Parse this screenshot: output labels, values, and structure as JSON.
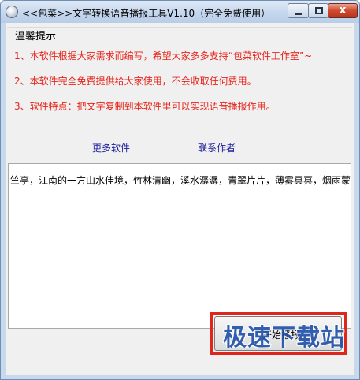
{
  "window": {
    "title": "<<包菜>>文字转换语音播报工具V1.10（完全免费使用）"
  },
  "titlebar_buttons": {
    "close_glyph": "x"
  },
  "info": {
    "group_title": "温馨提示",
    "notes": [
      "1、本软件根据大家需求而编写，希望大家多多支持“包菜软件工作室”~",
      "2、本软件完全免费提供给大家使用，不会收取任何费用。",
      "3、软件特点：把文字复制到本软件里可以实现语音播报作用。"
    ],
    "note_color": "#e8231a"
  },
  "links": {
    "more_software": "更多软件",
    "contact_author": "联系作者"
  },
  "text_input": {
    "value": "竺亭，江南的一方山水佳境，竹林清幽，溪水潺潺，青翠片片，薄雾冥冥，烟雨蒙"
  },
  "start_button": {
    "label": "开始播报"
  },
  "watermark": {
    "text": "极速下载站"
  }
}
